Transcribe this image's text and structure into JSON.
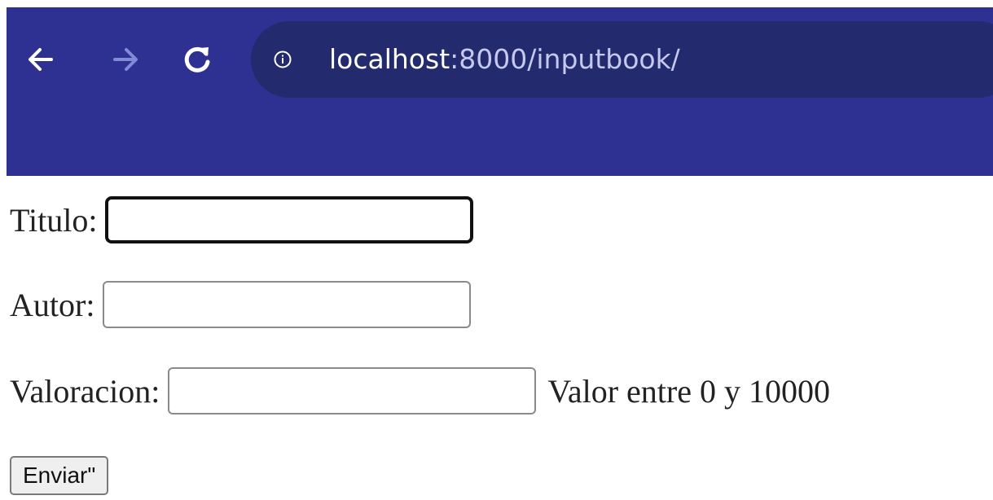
{
  "browser": {
    "url_host": "localhost",
    "url_rest": ":8000/inputbook/",
    "icons": [
      "back-arrow-icon",
      "forward-arrow-icon",
      "reload-icon",
      "info-icon"
    ],
    "colors": {
      "toolbar": "#2e3192",
      "omnibox": "#232a6e",
      "forward_disabled": "#7f8bd6"
    }
  },
  "form": {
    "titulo_label": "Titulo:",
    "titulo_value": "",
    "autor_label": "Autor:",
    "autor_value": "",
    "valoracion_label": "Valoracion:",
    "valoracion_value": "",
    "valoracion_hint": "Valor entre 0 y 10000",
    "submit_label": "Enviar\""
  }
}
